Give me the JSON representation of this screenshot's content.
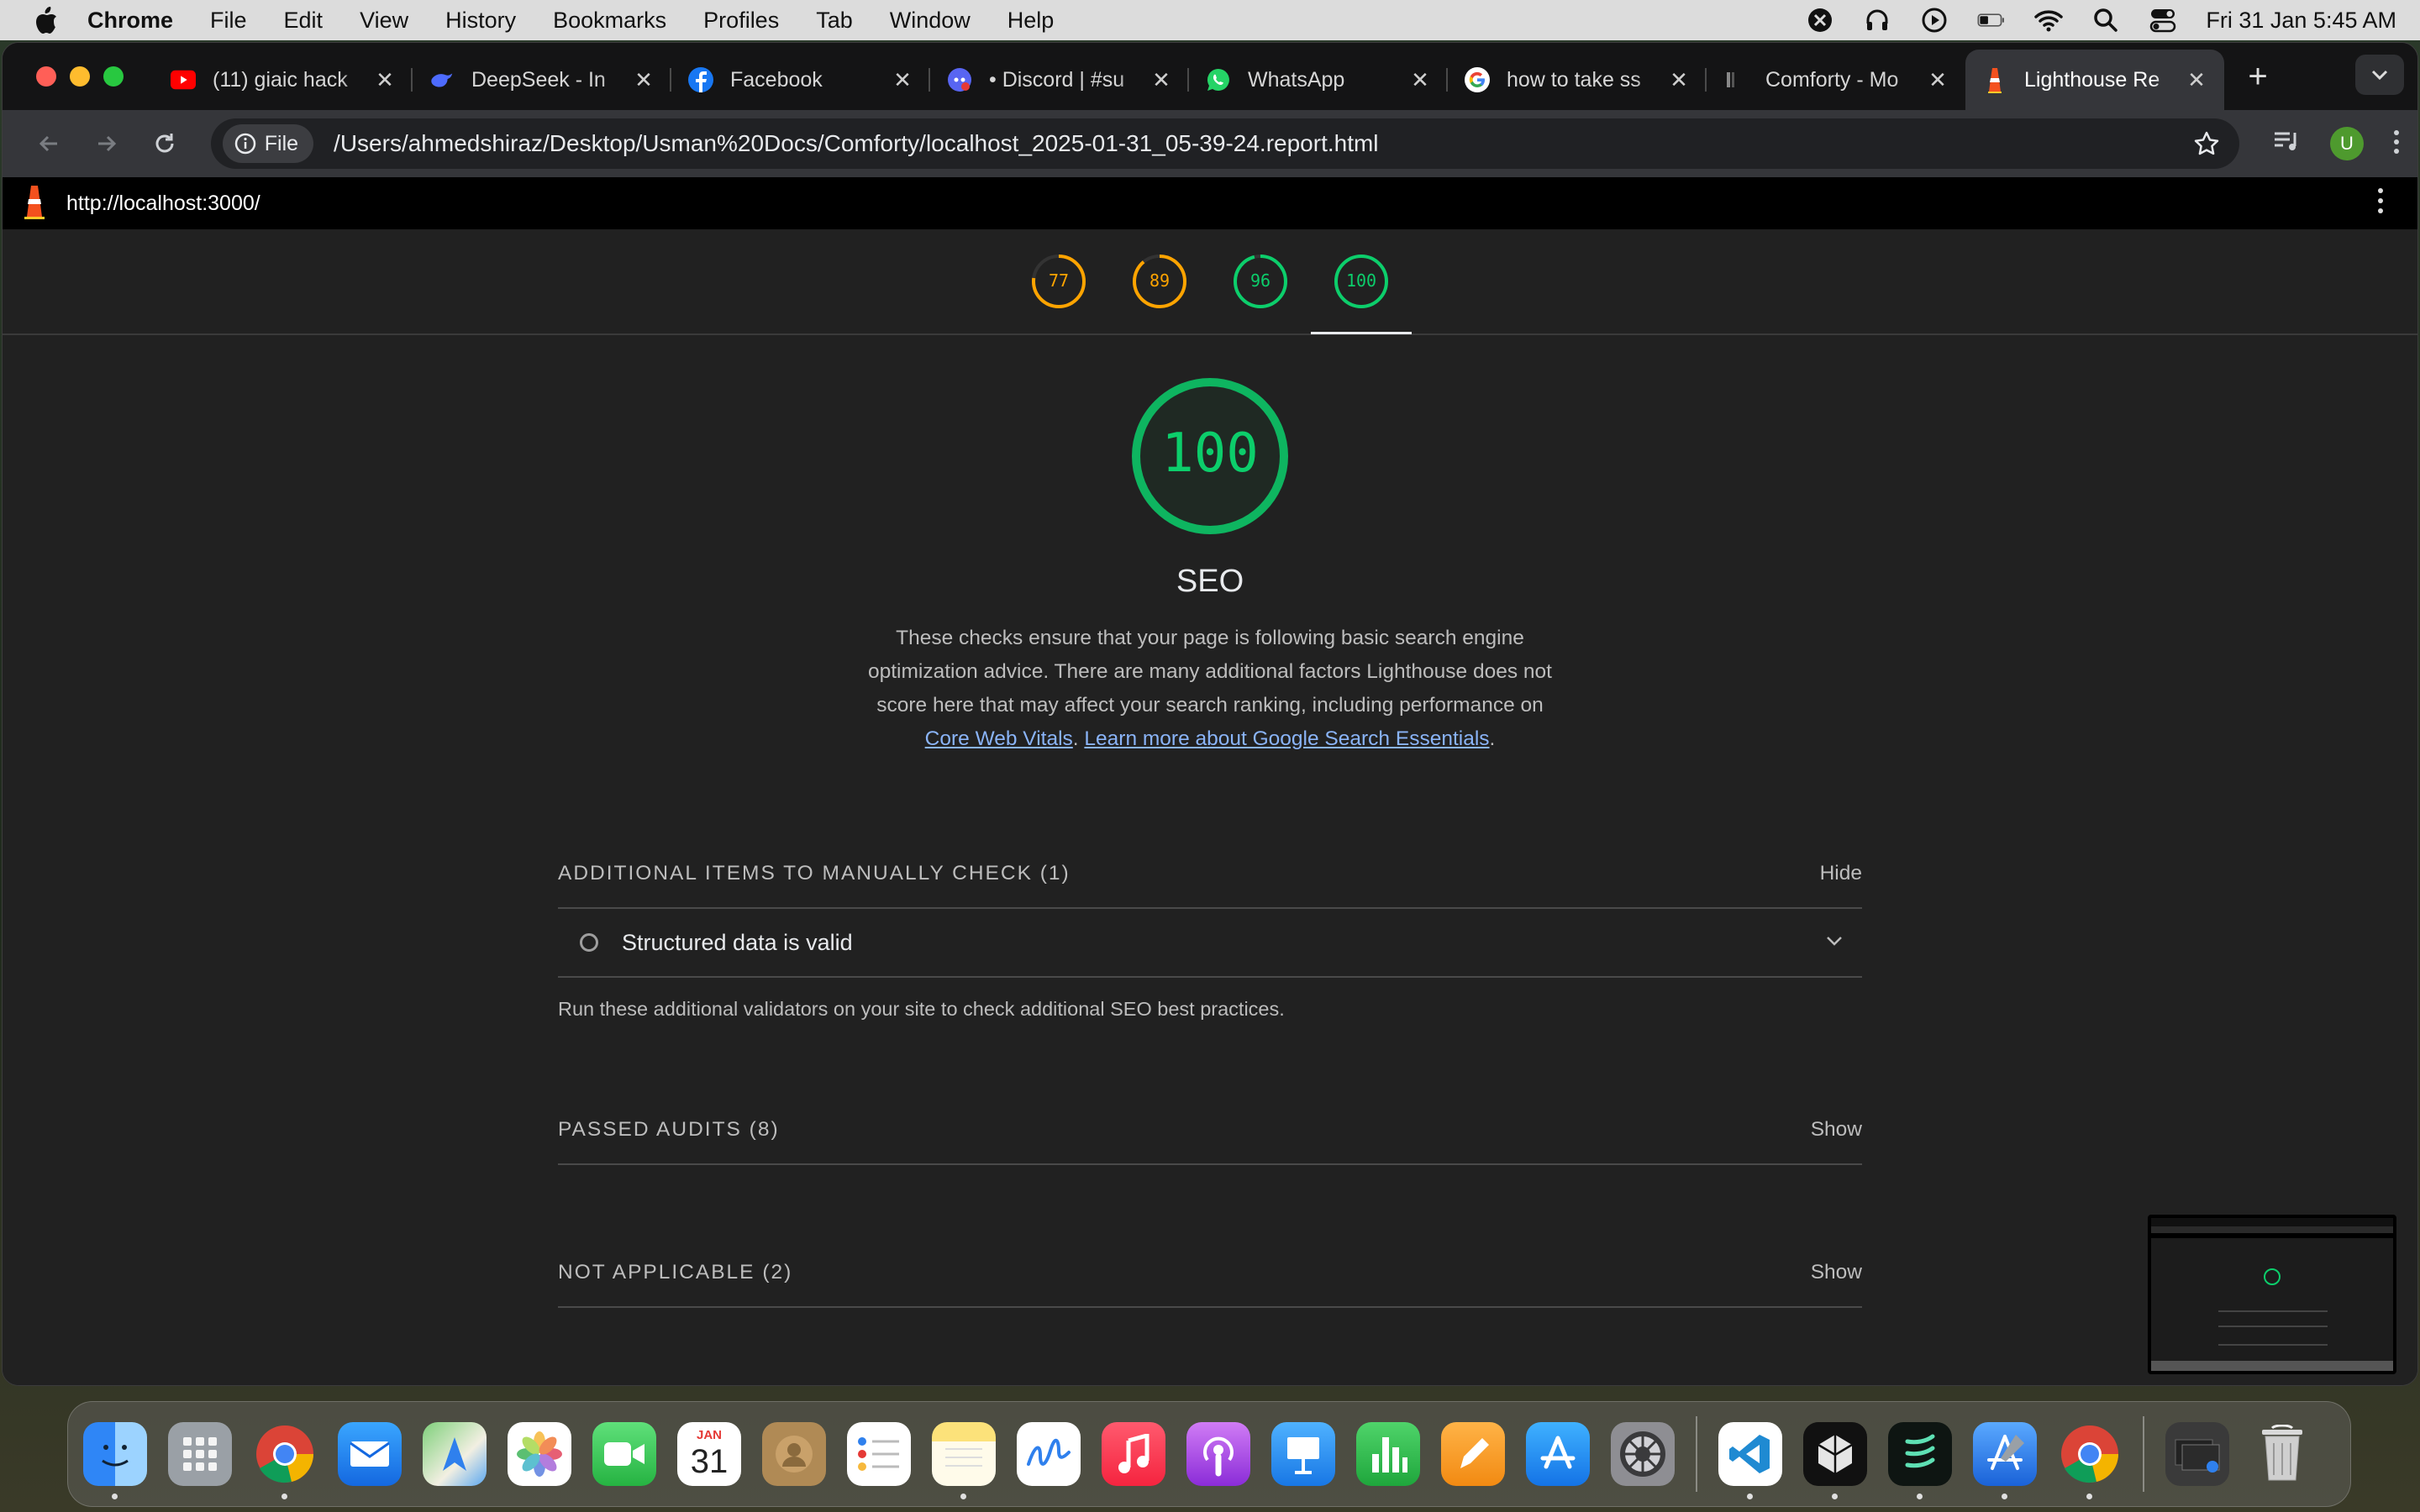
{
  "menubar": {
    "app_name": "Chrome",
    "items": [
      "File",
      "Edit",
      "View",
      "History",
      "Bookmarks",
      "Profiles",
      "Tab",
      "Window",
      "Help"
    ],
    "clock": "Fri 31 Jan  5:45 AM"
  },
  "tabs": [
    {
      "title": "(11) giaic hack",
      "favicon": "youtube-icon",
      "color": "#ff0000"
    },
    {
      "title": "DeepSeek - In",
      "favicon": "deepseek-icon",
      "color": "#4d6bfe"
    },
    {
      "title": "Facebook",
      "favicon": "facebook-icon",
      "color": "#1877f2"
    },
    {
      "title": "• Discord | #su",
      "favicon": "discord-icon",
      "color": "#5865f2"
    },
    {
      "title": "WhatsApp",
      "favicon": "whatsapp-icon",
      "color": "#25d366"
    },
    {
      "title": "how to take ss",
      "favicon": "google-icon",
      "color": "#ffffff"
    },
    {
      "title": "Comforty - Mo",
      "favicon": "comforty-icon",
      "color": "#888888"
    },
    {
      "title": "Lighthouse Re",
      "favicon": "lighthouse-icon",
      "color": "#f4511e",
      "active": true
    }
  ],
  "omnibox": {
    "chip_label": "File",
    "url": "/Users/ahmedshiraz/Desktop/Usman%20Docs/Comforty/localhost_2025-01-31_05-39-24.report.html"
  },
  "profile_initial": "U",
  "report": {
    "url": "http://localhost:3000/",
    "gauges": [
      {
        "score": 77,
        "color": "#ffa400"
      },
      {
        "score": 89,
        "color": "#ffa400"
      },
      {
        "score": 96,
        "color": "#0cce6b"
      },
      {
        "score": 100,
        "color": "#0cce6b",
        "active": true
      }
    ],
    "category": {
      "score": "100",
      "title": "SEO",
      "description": "These checks ensure that your page is following basic search engine optimization advice. There are many additional factors Lighthouse does not score here that may affect your search ranking, including performance on",
      "link1": "Core Web Vitals",
      "sep": ". ",
      "link2": "Learn more about Google Search Essentials",
      "end": "."
    },
    "manual": {
      "heading": "ADDITIONAL ITEMS TO MANUALLY CHECK (1)",
      "toggle": "Hide",
      "audit": "Structured data is valid",
      "note": "Run these additional validators on your site to check additional SEO best practices."
    },
    "passed": {
      "heading": "PASSED AUDITS (8)",
      "toggle": "Show"
    },
    "not_applicable": {
      "heading": "NOT APPLICABLE (2)",
      "toggle": "Show"
    }
  },
  "dock": {
    "calendar_month": "JAN",
    "calendar_day": "31"
  }
}
